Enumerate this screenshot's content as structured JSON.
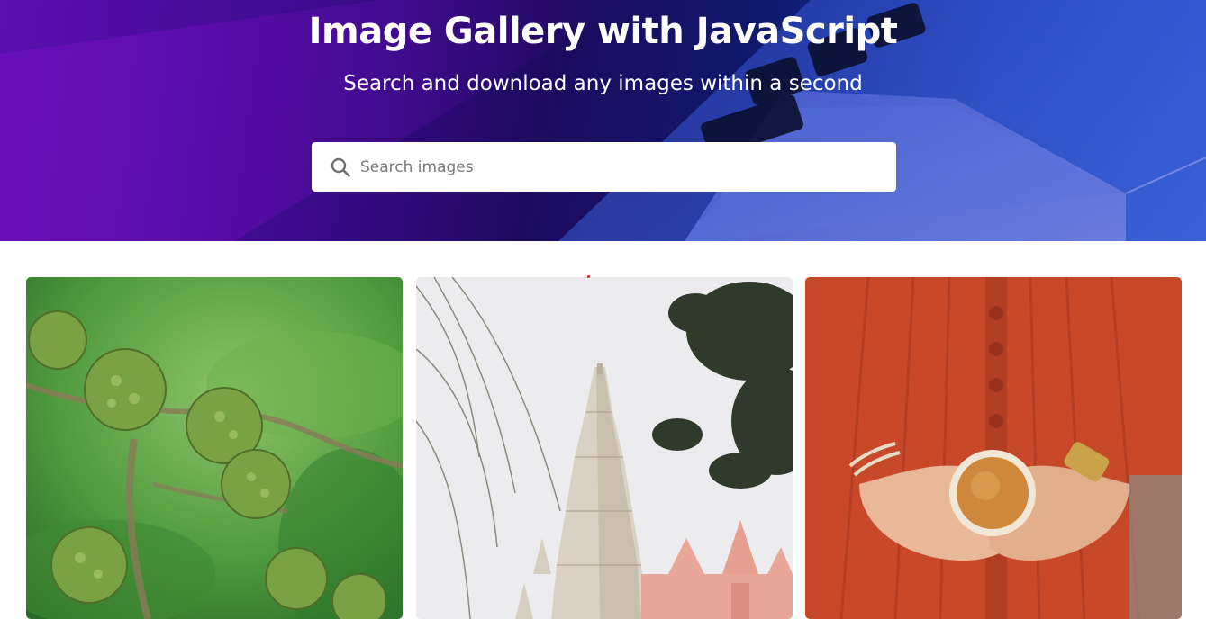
{
  "hero": {
    "title": "Image Gallery with JavaScript",
    "subtitle": "Search and download any images within a second"
  },
  "search": {
    "placeholder": "Search images",
    "value": ""
  },
  "gallery": {
    "images": [
      {
        "name": "blackberry-branch-image"
      },
      {
        "name": "temple-tower-image"
      },
      {
        "name": "coffee-cup-hands-image"
      }
    ]
  },
  "colors": {
    "hero_left": "#5a0fb0",
    "hero_right": "#2a55c8",
    "search_bg": "#ffffff",
    "page_bg": "#ffffff"
  },
  "icons": {
    "search": "search-icon"
  }
}
